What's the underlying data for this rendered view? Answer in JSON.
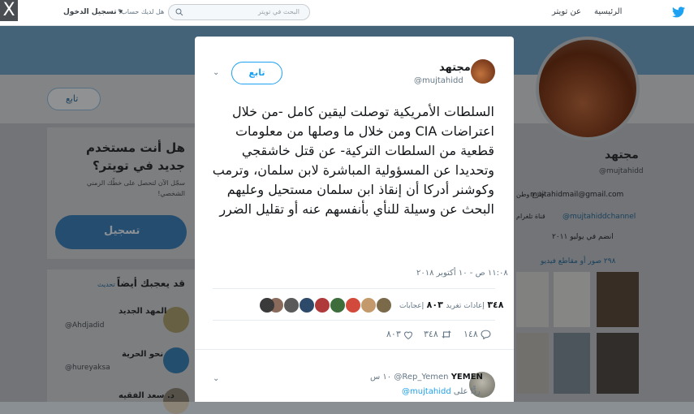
{
  "topbar": {
    "home": "الرئيسية",
    "about": "عن تويتر",
    "search_placeholder": "البحث في تويتر",
    "have_account": "هل لديك حساب؟",
    "login": "تسجيل الدخول"
  },
  "close_label": "X",
  "colors": {
    "accent": "#1da1f2",
    "banner": "#6f9ec2"
  },
  "background": {
    "follow": "تابع",
    "new_user_title": "هل أنت مستخدم جديد في تويتر؟",
    "new_user_sub": "سجّل الآن لتحصل على خطّك الزمني الشخصي!",
    "signup": "تسجيل",
    "may_like": "قد يعجبك أيضاً",
    "refresh": "تحديث",
    "suggestions": [
      {
        "name": "المهد الجديد",
        "handle": "@Ahdjadid"
      },
      {
        "name": "نحو الحرية",
        "handle": "@hureyaksa"
      },
      {
        "name": "د. سعد الفقيه",
        "handle": ""
      }
    ],
    "profile_name": "مجتهد",
    "profile_handle": "@mujtahidd",
    "email": "mujtahidmail@gmail.com",
    "channel": "@mujtahiddchannel",
    "channel_label": "قناة تلغرام",
    "joined": "انضم في يوليو ٢٠١١",
    "media": "٢٩٨ صور أو مقاطع فيديو",
    "location_label": "خارج وطن"
  },
  "tweet": {
    "name": "مجتهد",
    "handle": "@mujtahidd",
    "follow": "تابع",
    "text": "السلطات الأمريكية توصلت ليقين كامل -من خلال اعتراضات CIA ومن خلال ما وصلها من معلومات قطعية من السلطات التركية- عن قتل خاشقجي وتحديدا عن المسؤولية المباشرة لابن سلمان، وترمب وكوشنر أدركا أن إنقاذ ابن سلمان مستحيل وعليهم البحث عن وسيلة للنأي بأنفسهم عنه أو تقليل الضرر",
    "timestamp": "١١:٠٨ ص - ١٠ أكتوبر ٢٠١٨",
    "retweets_count": "٣٤٨",
    "retweets_label": "إعادات تغريد",
    "likes_count": "٨٠٣",
    "likes_label": "إعجابات",
    "reply_count": "١٤٨",
    "rt_count": "٣٤٨",
    "like_count": "٨٠٣"
  },
  "reply": {
    "name": "YEMEN",
    "handle": "@Rep_Yemen",
    "time": "١٠ س",
    "replying_to": "ردًّا على",
    "replying_handle": "@mujtahidd"
  }
}
